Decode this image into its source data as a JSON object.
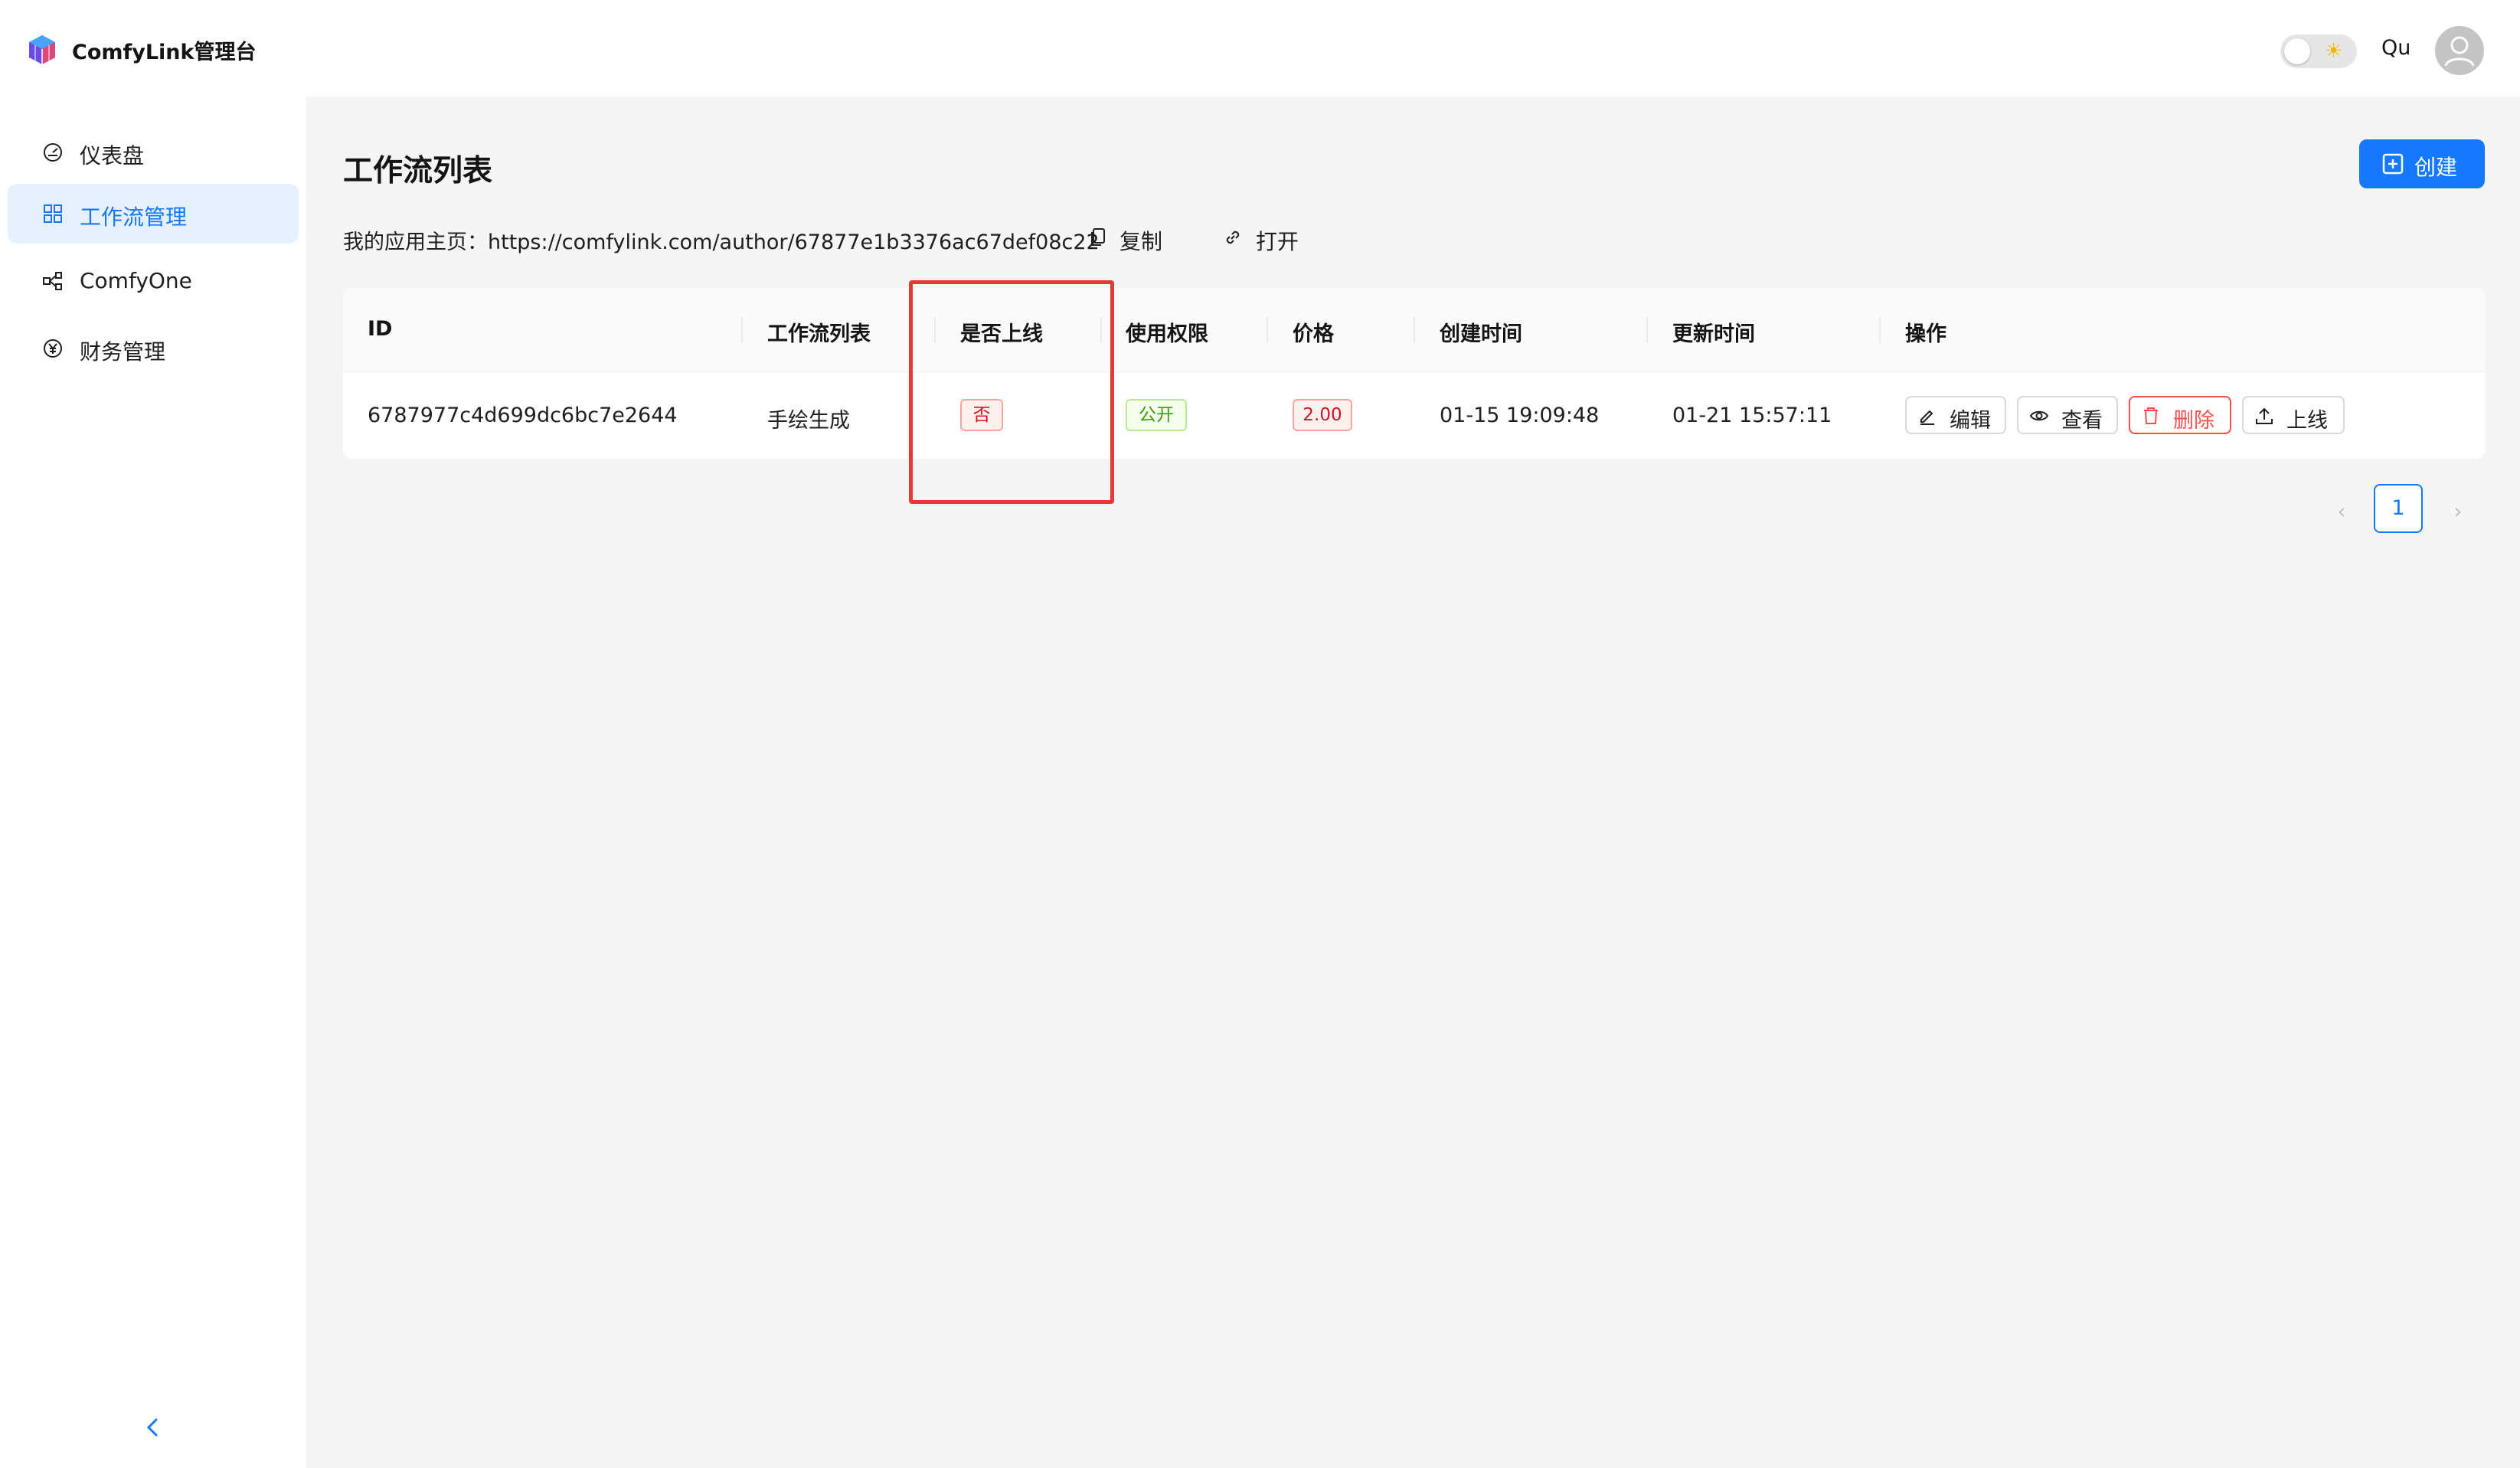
{
  "header": {
    "app_title": "ComfyLink管理台",
    "user_name": "Qu",
    "theme_toggle_icon": "sun-icon"
  },
  "sidebar": {
    "items": [
      {
        "label": "仪表盘",
        "icon": "dashboard-icon",
        "active": false
      },
      {
        "label": "工作流管理",
        "icon": "grid-icon",
        "active": true
      },
      {
        "label": "ComfyOne",
        "icon": "nodes-icon",
        "active": false
      },
      {
        "label": "财务管理",
        "icon": "yen-icon",
        "active": false
      }
    ],
    "collapse_icon": "chevron-left-icon"
  },
  "main": {
    "page_title": "工作流列表",
    "create_label": "创建",
    "home_prefix": "我的应用主页：",
    "home_url": "https://comfylink.com/author/67877e1b3376ac67def08c22",
    "copy_label": "复制",
    "open_label": "打开"
  },
  "table": {
    "columns": [
      "ID",
      "工作流列表",
      "是否上线",
      "使用权限",
      "价格",
      "创建时间",
      "更新时间",
      "操作"
    ],
    "rows": [
      {
        "id": "6787977c4d699dc6bc7e2644",
        "name": "手绘生成",
        "online": "否",
        "permission": "公开",
        "price": "2.00",
        "created": "01-15 19:09:48",
        "updated": "01-21 15:57:11",
        "actions": [
          "编辑",
          "查看",
          "删除",
          "上线"
        ]
      }
    ]
  },
  "pagination": {
    "current_page": "1",
    "prev_icon": "chevron-left-icon",
    "next_icon": "chevron-right-icon"
  },
  "colors": {
    "accent": "#1677ff",
    "danger": "#ff4d4f",
    "highlight": "#e53935",
    "success": "#389e0d"
  }
}
